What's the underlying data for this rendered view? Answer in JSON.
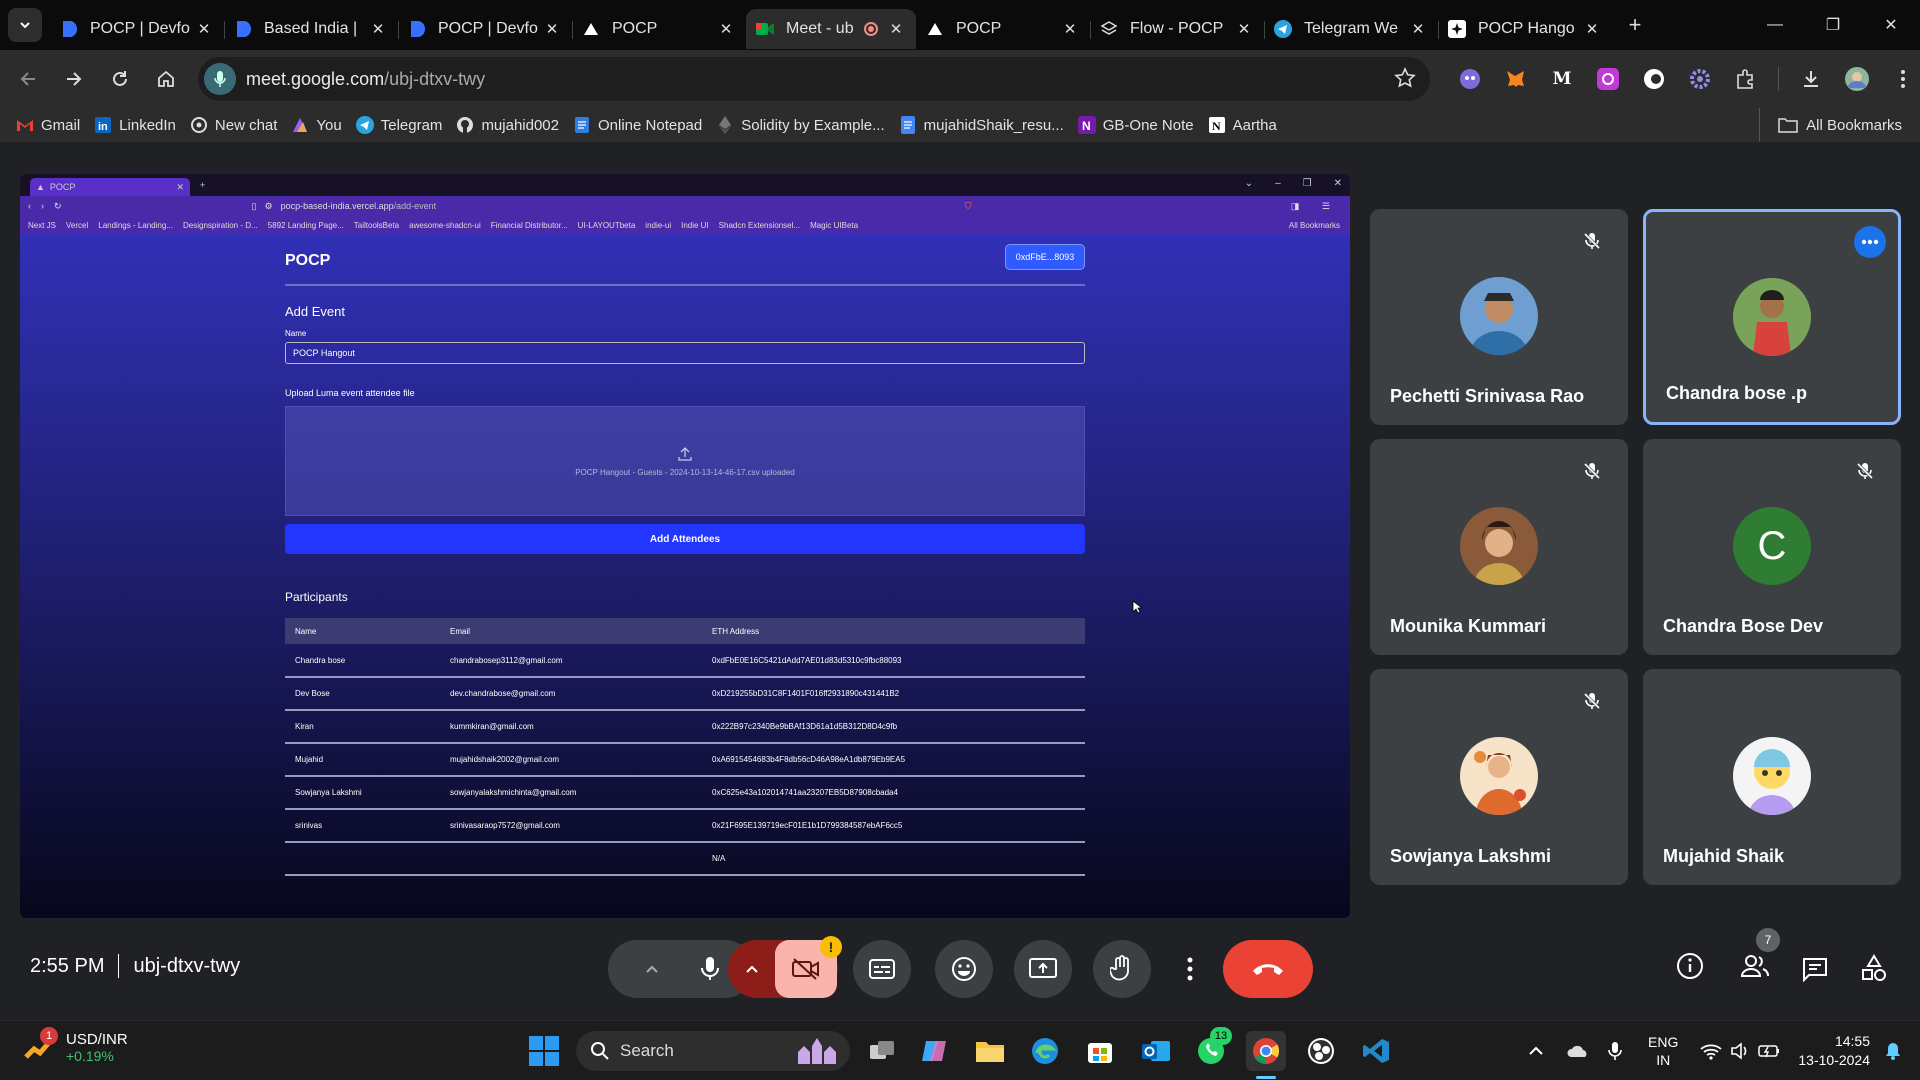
{
  "browser": {
    "tabs": [
      {
        "title": "POCP | Devfo",
        "favicon": "devfolio-icon",
        "active": false
      },
      {
        "title": "Based India |",
        "favicon": "devfolio-icon",
        "active": false
      },
      {
        "title": "POCP | Devfo",
        "favicon": "devfolio-icon",
        "active": false
      },
      {
        "title": "POCP",
        "favicon": "vercel-icon",
        "active": false
      },
      {
        "title": "Meet - ub",
        "favicon": "meet-icon",
        "active": true
      },
      {
        "title": "POCP",
        "favicon": "vercel-icon",
        "active": false
      },
      {
        "title": "Flow - POCP",
        "favicon": "layers-icon",
        "active": false
      },
      {
        "title": "Telegram We",
        "favicon": "telegram-icon",
        "active": false
      },
      {
        "title": "POCP Hango",
        "favicon": "sparkle-icon",
        "active": false
      }
    ],
    "url_host": "meet.google.com",
    "url_path": "/ubj-dtxv-twy",
    "bookmarks": [
      {
        "label": "Gmail",
        "icon": "gmail-icon"
      },
      {
        "label": "LinkedIn",
        "icon": "linkedin-icon"
      },
      {
        "label": "New chat",
        "icon": "openai-icon"
      },
      {
        "label": "You",
        "icon": "you-icon"
      },
      {
        "label": "Telegram",
        "icon": "telegram-icon"
      },
      {
        "label": "mujahid002",
        "icon": "github-icon"
      },
      {
        "label": "Online Notepad",
        "icon": "notepad-icon"
      },
      {
        "label": "Solidity by Example...",
        "icon": "ethereum-icon"
      },
      {
        "label": "mujahidShaik_resu...",
        "icon": "doc-icon"
      },
      {
        "label": "GB-One Note",
        "icon": "onenote-icon"
      },
      {
        "label": "Aartha",
        "icon": "notion-icon"
      }
    ],
    "all_bookmarks": "All Bookmarks"
  },
  "shared_screen": {
    "tab_title": "POCP",
    "url_host": "pocp-based-india.vercel.app",
    "url_path": "/add-event",
    "bookmarks": [
      "Next JS",
      "Vercel",
      "Landings - Landing...",
      "Designspiration - D...",
      "5892 Landing Page...",
      "TailtoolsBeta",
      "awesome-shadcn-ui",
      "Financial Distributor...",
      "UI-LAYOUTbeta",
      "indie-ui",
      "Indie UI",
      "Shadcn Extensionsel...",
      "Magic UIBeta",
      "All Bookmarks"
    ],
    "brand": "POCP",
    "wallet": "0xdFbE...8093",
    "heading": "Add Event",
    "name_label": "Name",
    "name_value": "POCP Hangout",
    "upload_label": "Upload Luma event attendee file",
    "upload_status": "POCP Hangout - Guests - 2024-10-13-14-46-17.csv uploaded",
    "add_button": "Add Attendees",
    "participants_heading": "Participants",
    "columns": [
      "Name",
      "Email",
      "ETH Address"
    ],
    "rows": [
      [
        "Chandra bose",
        "chandrabosep3112@gmail.com",
        "0xdFbE0E16C5421dAdd7AE01d83d5310c9fbc88093"
      ],
      [
        "Dev Bose",
        "dev.chandrabose@gmail.com",
        "0xD219255bD31C8F1401F016ff2931890c431441B2"
      ],
      [
        "Kiran",
        "kummkiran@gmail.com",
        "0x222B97c2340Be9bBAf13D61a1d5B312D8D4c9fb"
      ],
      [
        "Mujahid",
        "mujahidshaik2002@gmail.com",
        "0xA6915454683b4F8db56cD46A98eA1db879Eb9EA5"
      ],
      [
        "Sowjanya Lakshmi",
        "sowjanyalakshmichinta@gmail.com",
        "0xC625e43a102014741aa23207EB5D87908cbada4"
      ],
      [
        "srinivas",
        "srinivasaraop7572@gmail.com",
        "0x21F695E139719ecF01E1b1D799384587ebAF6cc5"
      ],
      [
        "",
        "",
        "N/A"
      ]
    ]
  },
  "participants": [
    {
      "name": "Pechetti Srinivasa Rao",
      "muted": true
    },
    {
      "name": "Chandra bose .p",
      "muted": false
    },
    {
      "name": "Mounika Kummari",
      "muted": true
    },
    {
      "name": "Chandra Bose Dev",
      "muted": true,
      "initial": "C"
    },
    {
      "name": "Sowjanya Lakshmi",
      "muted": true
    },
    {
      "name": "Mujahid Shaik",
      "muted": false
    }
  ],
  "meeting": {
    "time": "2:55 PM",
    "code": "ubj-dtxv-twy",
    "people_count": "7"
  },
  "taskbar": {
    "widget_title": "USD/INR",
    "widget_value": "+0.19%",
    "widget_badge": "1",
    "search": "Search",
    "whatsapp_badge": "13",
    "lang1": "ENG",
    "lang2": "IN",
    "time": "14:55",
    "date": "13-10-2024"
  },
  "colors": {
    "accent": "#1a73e8",
    "end_call": "#ea4335",
    "camera_off": "#f9b4ab"
  }
}
